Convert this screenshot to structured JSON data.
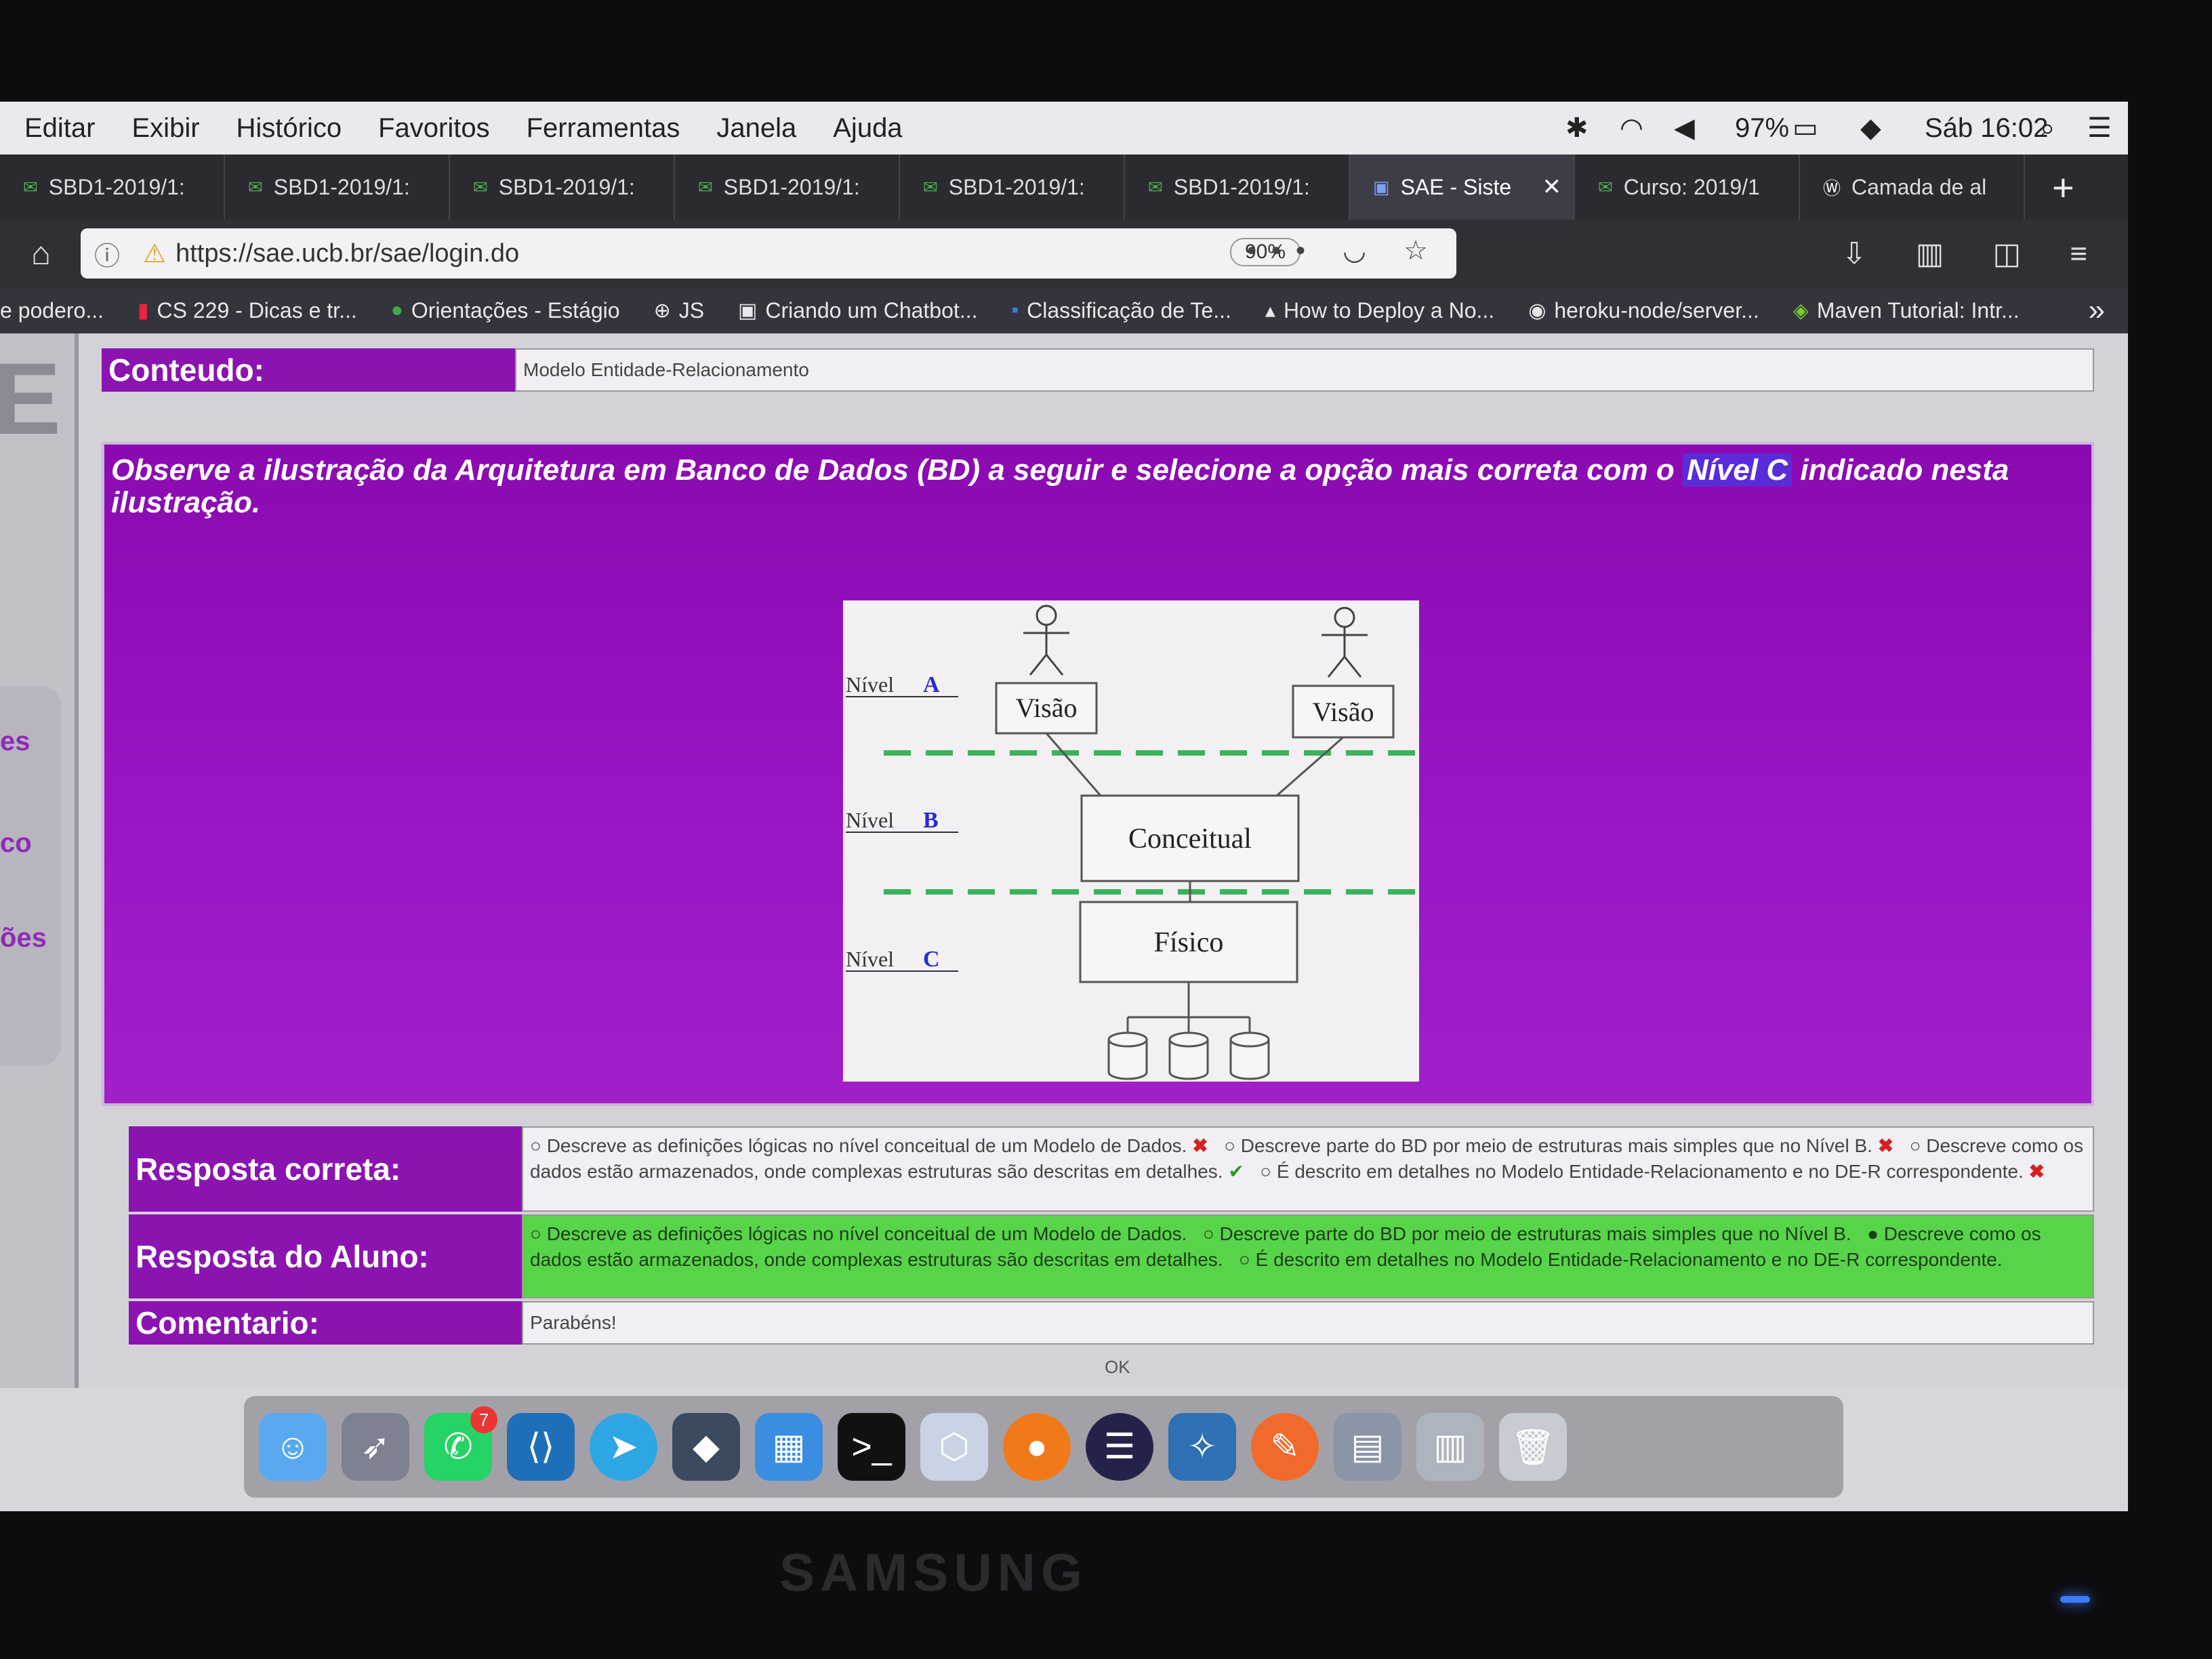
{
  "menubar": {
    "items": [
      "Editar",
      "Exibir",
      "Histórico",
      "Favoritos",
      "Ferramentas",
      "Janela",
      "Ajuda"
    ],
    "battery": "97%",
    "clock": "Sáb 16:02"
  },
  "tabs": [
    {
      "label": "SBD1-2019/1:",
      "icon": "gmail-icon"
    },
    {
      "label": "SBD1-2019/1:",
      "icon": "gmail-icon"
    },
    {
      "label": "SBD1-2019/1:",
      "icon": "gmail-icon"
    },
    {
      "label": "SBD1-2019/1:",
      "icon": "gmail-icon"
    },
    {
      "label": "SBD1-2019/1:",
      "icon": "gmail-icon"
    },
    {
      "label": "SBD1-2019/1:",
      "icon": "gmail-icon"
    },
    {
      "label": "SAE - Siste",
      "icon": "sae-icon",
      "active": true
    },
    {
      "label": "Curso: 2019/1",
      "icon": "gmail-icon"
    },
    {
      "label": "Camada de al",
      "icon": "w-icon"
    }
  ],
  "navbar": {
    "url": "https://sae.ucb.br/sae/login.do",
    "zoom": "90%",
    "more": "•••"
  },
  "bookmarks": [
    {
      "label": "e podero..."
    },
    {
      "label": "CS 229 - Dicas e tr..."
    },
    {
      "label": "Orientações - Estágio"
    },
    {
      "label": "JS"
    },
    {
      "label": "Criando um Chatbot..."
    },
    {
      "label": "Classificação de Te..."
    },
    {
      "label": "How to Deploy a No..."
    },
    {
      "label": "heroku-node/server..."
    },
    {
      "label": "Maven Tutorial: Intr..."
    }
  ],
  "sidebar": {
    "letter": "E",
    "links": [
      "es",
      "co",
      "ões"
    ]
  },
  "content": {
    "label": "Conteudo:",
    "value": "Modelo Entidade-Relacionamento"
  },
  "question": {
    "text_before": "Observe a ilustração da Arquitetura em Banco de Dados (BD) a seguir e selecione a opção mais correta com o ",
    "highlight": "Nível C",
    "text_after": " indicado nesta ilustração."
  },
  "figure": {
    "levels": [
      {
        "prefix": "Nível",
        "letter": "A"
      },
      {
        "prefix": "Nível",
        "letter": "B"
      },
      {
        "prefix": "Nível",
        "letter": "C"
      }
    ],
    "view_left": "Visão",
    "view_right": "Visão",
    "conceptual": "Conceitual",
    "physical": "Físico",
    "level_color": "#2b2bd0",
    "dash_color": "#3cb35a"
  },
  "answers": {
    "correct_label": "Resposta correta:",
    "student_label": "Resposta do Aluno:",
    "comment_label": "Comentario:",
    "option1": "Descreve as definições lógicas no nível conceitual de um Modelo de Dados.",
    "option2": "Descreve parte do BD por meio de estruturas mais simples que no Nível B.",
    "option3": "Descreve como os dados estão armazenados, onde complexas estruturas são descritas em detalhes.",
    "option4": "É descrito em detalhes no Modelo Entidade-Relacionamento e no DE-R correspondente.",
    "correct_text_tail": "Entidade-Relacionamento e no DE-R correspondente.",
    "student_tail": "Relacionamento e no DE-R correspondente.",
    "comment": "Parabéns!",
    "ok_button": "OK"
  },
  "dock": {
    "whatsapp_badge": "7"
  },
  "monitor": {
    "brand": "SAMSUNG"
  },
  "colors": {
    "purple": "#8b14b0",
    "student_green": "#58d44a"
  }
}
